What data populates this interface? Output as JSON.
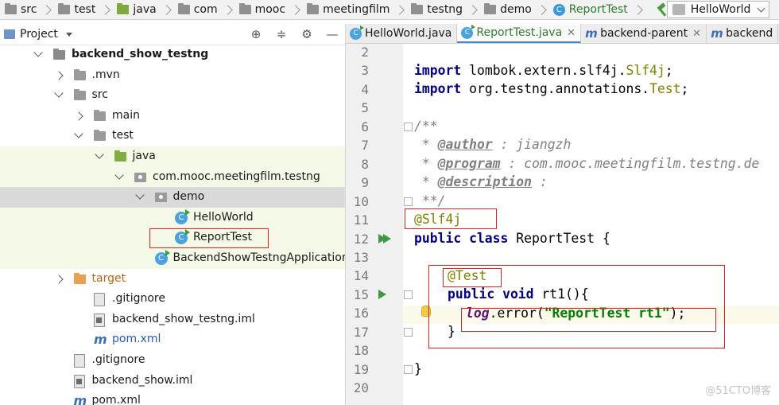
{
  "breadcrumb": {
    "items": [
      "src",
      "test",
      "java",
      "com",
      "mooc",
      "meetingfilm",
      "testng",
      "demo",
      "ReportTest"
    ],
    "run_config": "HelloWorld"
  },
  "project_panel": {
    "title": "Project",
    "tree": [
      {
        "label": "backend_show_testng",
        "depth": 0,
        "arrow": "down",
        "icon": "project-folder-icon"
      },
      {
        "label": ".mvn",
        "depth": 1,
        "arrow": "right",
        "icon": "folder-icon"
      },
      {
        "label": "src",
        "depth": 1,
        "arrow": "down",
        "icon": "folder-icon"
      },
      {
        "label": "main",
        "depth": 2,
        "arrow": "right",
        "icon": "folder-icon"
      },
      {
        "label": "test",
        "depth": 2,
        "arrow": "down",
        "icon": "folder-icon"
      },
      {
        "label": "java",
        "depth": 3,
        "arrow": "down",
        "icon": "test-source-folder-icon"
      },
      {
        "label": "com.mooc.meetingfilm.testng",
        "depth": 4,
        "arrow": "down",
        "icon": "package-icon"
      },
      {
        "label": "demo",
        "depth": 5,
        "arrow": "down",
        "icon": "package-icon"
      },
      {
        "label": "HelloWorld",
        "depth": 6,
        "arrow": "",
        "icon": "test-class-icon"
      },
      {
        "label": "ReportTest",
        "depth": 6,
        "arrow": "",
        "icon": "test-class-icon"
      },
      {
        "label": "BackendShowTestngApplicationT",
        "depth": 5,
        "arrow": "",
        "icon": "test-class-icon"
      },
      {
        "label": "target",
        "depth": 1,
        "arrow": "right",
        "icon": "excluded-folder-icon"
      },
      {
        "label": ".gitignore",
        "depth": 2,
        "arrow": "",
        "icon": "gitignore-file-icon"
      },
      {
        "label": "backend_show_testng.iml",
        "depth": 2,
        "arrow": "",
        "icon": "iml-file-icon"
      },
      {
        "label": "pom.xml",
        "depth": 2,
        "arrow": "",
        "icon": "maven-icon"
      },
      {
        "label": ".gitignore",
        "depth": 1,
        "arrow": "",
        "icon": "gitignore-file-icon"
      },
      {
        "label": "backend_show.iml",
        "depth": 1,
        "arrow": "",
        "icon": "iml-file-icon"
      },
      {
        "label": "pom.xml",
        "depth": 1,
        "arrow": "",
        "icon": "maven-icon"
      }
    ]
  },
  "editor": {
    "tabs": [
      {
        "label": "HelloWorld.java",
        "icon": "java-class-icon",
        "active": false,
        "closable": false
      },
      {
        "label": "ReportTest.java",
        "icon": "java-class-icon",
        "active": true,
        "closable": true
      },
      {
        "label": "backend-parent",
        "icon": "maven-icon",
        "active": false,
        "closable": true
      },
      {
        "label": "backend",
        "icon": "maven-icon",
        "active": false,
        "closable": false
      }
    ],
    "line_numbers": [
      "2",
      "3",
      "4",
      "5",
      "6",
      "7",
      "8",
      "9",
      "10",
      "11",
      "12",
      "13",
      "14",
      "15",
      "16",
      "17",
      "18",
      "19",
      "20"
    ],
    "code": {
      "l3_kw": "import",
      "l3_rest": " lombok.extern.slf4j.",
      "l3_cls": "Slf4j",
      "l3_end": ";",
      "l4_kw": "import",
      "l4_rest": " org.testng.annotations.",
      "l4_cls": "Test",
      "l4_end": ";",
      "l6": "/**",
      "l7_pre": " * ",
      "l7_tag": "@author",
      "l7_val": " : jiangzh",
      "l8_pre": " * ",
      "l8_tag": "@program",
      "l8_val": " : com.mooc.meetingfilm.testng.de",
      "l9_pre": " * ",
      "l9_tag": "@description",
      "l9_val": " :",
      "l10": " **/",
      "l11": "@Slf4j",
      "l12_kw": "public class",
      "l12_rest": " ReportTest {",
      "l14": "@Test",
      "l15_kw": "public void",
      "l15_rest": " rt1(){",
      "l16_log": "log",
      "l16_mid": ".error(",
      "l16_str": "\"ReportTest rt1\"",
      "l16_end": ");",
      "l17": "}",
      "l19": "}"
    }
  },
  "watermark": "@51CTO博客",
  "colors": {
    "annotation_box": "#e02020",
    "keyword": "#000080",
    "annotation": "#808000",
    "string": "#008000"
  }
}
